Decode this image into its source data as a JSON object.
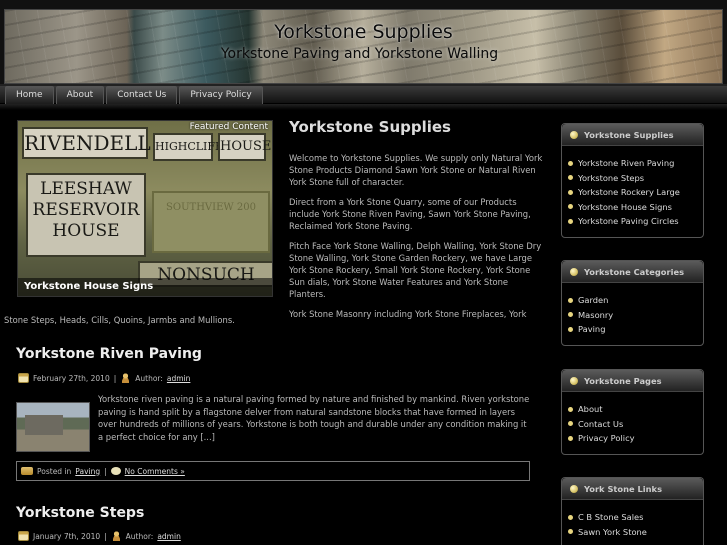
{
  "header": {
    "title": "Yorkstone Supplies",
    "description": "Yorkstone Paving and Yorkstone Walling"
  },
  "nav": {
    "items": [
      "Home",
      "About",
      "Contact Us",
      "Privacy Policy"
    ]
  },
  "featured": {
    "label": "Featured Content",
    "caption": "Yorkstone House Signs",
    "signs": [
      "RIVENDELL",
      "HIGHCLIFFE",
      "HOUSE",
      "LEESHAW RESERVOIR HOUSE",
      "SOUTHVIEW 200",
      "NONSUCH"
    ]
  },
  "intro": {
    "title": "Yorkstone Supplies",
    "paragraphs": [
      "Welcome to Yorkstone Supplies. We supply only Natural York Stone Products Diamond Sawn York Stone or Natural Riven York Stone full of character.",
      "Direct from a York Stone Quarry, some of our Products include York Stone Riven Paving, Sawn York Stone Paving, Reclaimed York Stone Paving.",
      "Pitch Face York Stone Walling, Delph Walling, York Stone Dry Stone Walling, York Stone Garden Rockery, we have Large York Stone Rockery, Small York Stone Rockery, York Stone Sun dials, York Stone Water Features and York Stone Planters.",
      "York Stone Masonry including York Stone Fireplaces, York"
    ],
    "wrap": "Stone Steps, Heads, Cills, Quoins, Jarmbs and Mullions."
  },
  "posts": [
    {
      "title": "Yorkstone Riven Paving",
      "date": "February 27th, 2010",
      "author_label": "Author:",
      "author": "admin",
      "excerpt": "Yorkstone riven paving is a natural paving formed by nature and finished by mankind. Riven yorkstone paving is hand split by a flagstone delver from natural sandstone blocks that have formed in layers over hundreds of millions of years. Yorkstone is both tough and durable under any condition making it a perfect choice for any [...]",
      "posted_in": "Posted in",
      "category": "Paving",
      "separator": "|",
      "comments": "No Comments »"
    },
    {
      "title": "Yorkstone Steps",
      "date": "January 7th, 2010",
      "author_label": "Author:",
      "author": "admin"
    }
  ],
  "sidebar": {
    "widgets": [
      {
        "title": "Yorkstone Supplies",
        "items": [
          "Yorkstone Riven Paving",
          "Yorkstone Steps",
          "Yorkstone Rockery Large",
          "Yorkstone House Signs",
          "Yorkstone Paving Circles"
        ]
      },
      {
        "title": "Yorkstone Categories",
        "items": [
          "Garden",
          "Masonry",
          "Paving"
        ]
      },
      {
        "title": "Yorkstone Pages",
        "items": [
          "About",
          "Contact Us",
          "Privacy Policy"
        ]
      },
      {
        "title": "York Stone Links",
        "items": [
          "C B Stone Sales",
          "Sawn York Stone"
        ]
      }
    ]
  }
}
